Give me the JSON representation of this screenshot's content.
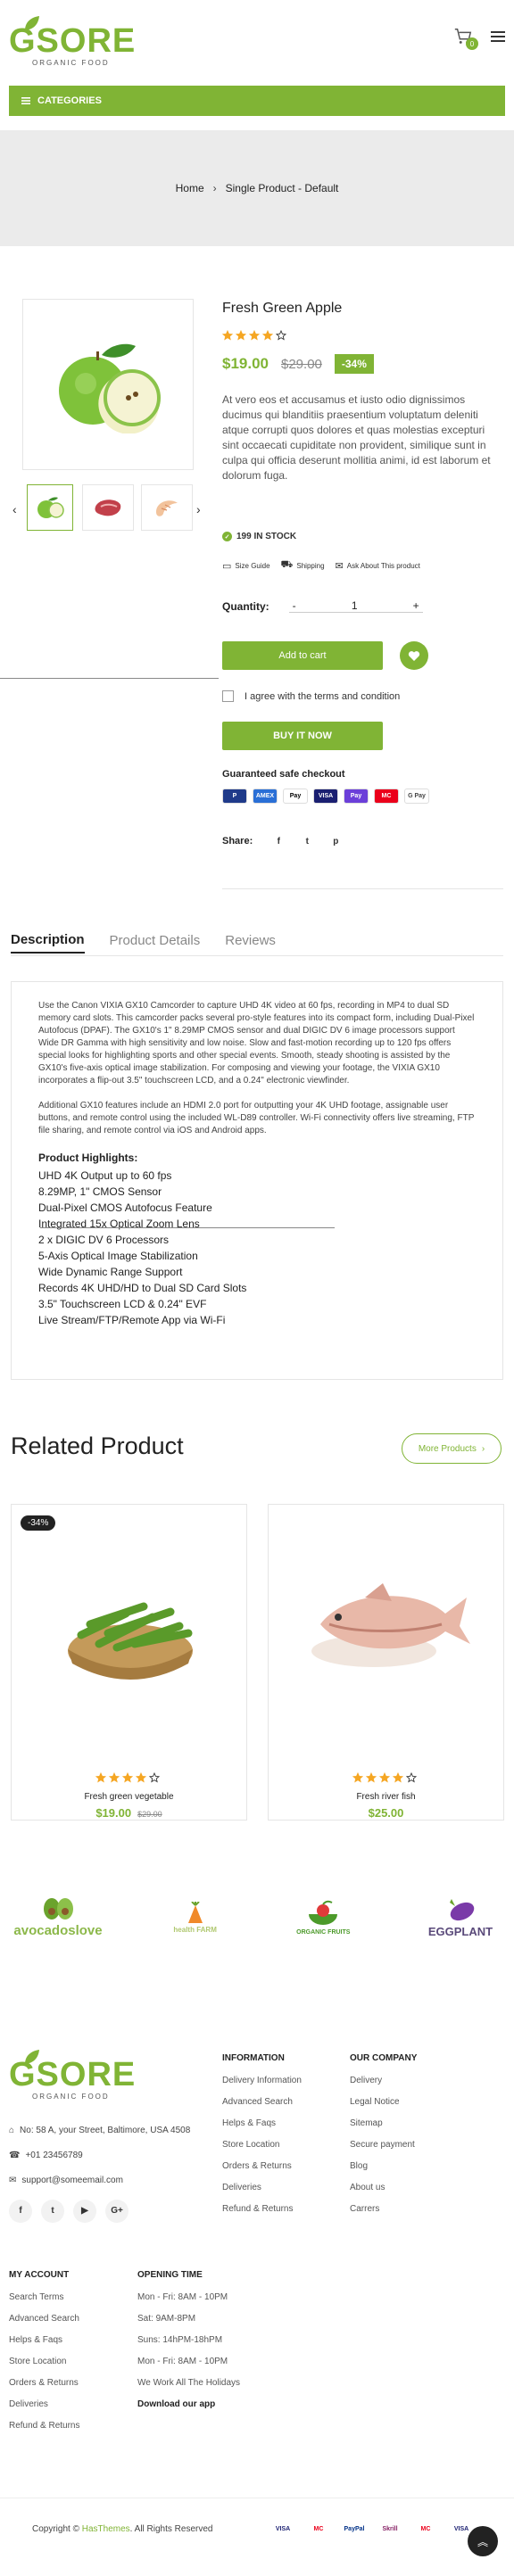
{
  "header": {
    "logo_main": "GSORE",
    "logo_sub": "ORGANIC FOOD",
    "cart_count": "0",
    "categories_label": "CATEGORIES"
  },
  "breadcrumb": {
    "home": "Home",
    "current": "Single Product - Default"
  },
  "product": {
    "title": "Fresh Green Apple",
    "price": "$19.00",
    "old_price": "$29.00",
    "discount": "-34%",
    "rating": 4,
    "description": "At vero eos et accusamus et iusto odio dignissimos ducimus qui blanditiis praesentium voluptatum deleniti atque corrupti quos dolores et quas molestias excepturi sint occaecati cupiditate non provident, similique sunt in culpa qui officia deserunt mollitia animi, id est laborum et dolorum fuga.",
    "stock": "199 IN STOCK",
    "size_guide": "Size Guide",
    "shipping": "Shipping",
    "ask": "Ask About This product",
    "quantity_label": "Quantity:",
    "quantity": "1",
    "minus": "-",
    "plus": "+",
    "add_to_cart": "Add to cart",
    "terms": "I agree with the terms and condition",
    "buy_now": "BUY IT NOW",
    "safe_checkout": "Guaranteed safe checkout",
    "share": "Share:",
    "payments": [
      "P",
      "AMEX",
      "Pay",
      "VISA",
      "Pay",
      "MC",
      "G Pay"
    ]
  },
  "tabs": [
    "Description",
    "Product Details",
    "Reviews"
  ],
  "description_tab": {
    "para1": "Use the Canon VIXIA GX10 Camcorder to capture UHD 4K video at 60 fps, recording in MP4 to dual SD memory card slots. This camcorder packs several pro-style features into its compact form, including Dual-Pixel Autofocus (DPAF). The GX10's 1\" 8.29MP CMOS sensor and dual DIGIC DV 6 image processors support Wide DR Gamma with high sensitivity and low noise. Slow and fast-motion recording up to 120 fps offers special looks for highlighting sports and other special events. Smooth, steady shooting is assisted by the GX10's five-axis optical image stabilization. For composing and viewing your footage, the VIXIA GX10 incorporates a flip-out 3.5\" touchscreen LCD, and a 0.24\" electronic viewfinder.",
    "para2": "Additional GX10 features include an HDMI 2.0 port for outputting your 4K UHD footage, assignable user buttons, and remote control using the included WL-D89 controller. Wi-Fi connectivity offers live streaming, FTP file sharing, and remote control via iOS and Android apps.",
    "highlights_title": "Product Highlights:",
    "highlights": [
      "UHD 4K Output up to 60 fps",
      "8.29MP, 1\" CMOS Sensor",
      "Dual-Pixel CMOS Autofocus Feature",
      "Integrated 15x Optical Zoom Lens",
      "2 x DIGIC DV 6 Processors",
      "5-Axis Optical Image Stabilization",
      "Wide Dynamic Range Support",
      "Records 4K UHD/HD to Dual SD Card Slots",
      "3.5\" Touchscreen LCD & 0.24\" EVF",
      "Live Stream/FTP/Remote App via Wi-Fi"
    ]
  },
  "related": {
    "title": "Related Product",
    "more": "More Products",
    "items": [
      {
        "badge": "-34%",
        "name": "Fresh green vegetable",
        "price": "$19.00",
        "old_price": "$29.00",
        "rating": 4
      },
      {
        "badge": "",
        "name": "Fresh river fish",
        "price": "$25.00",
        "old_price": "",
        "rating": 4
      }
    ]
  },
  "brands": [
    "avocadoslove",
    "health FARM",
    "ORGANIC FRUITS",
    "EGGPLANT"
  ],
  "footer": {
    "address": "No: 58 A, your Street, Baltimore, USA 4508",
    "phone": "+01 23456789",
    "email": "support@someemail.com",
    "information_title": "INFORMATION",
    "information": [
      "Delivery Information",
      "Advanced Search",
      "Helps & Faqs",
      "Store Location",
      "Orders & Returns",
      "Deliveries",
      "Refund & Returns"
    ],
    "company_title": "OUR COMPANY",
    "company": [
      "Delivery",
      "Legal Notice",
      "Sitemap",
      "Secure payment",
      "Blog",
      "About us",
      "Carrers"
    ],
    "account_title": "MY ACCOUNT",
    "account": [
      "Search Terms",
      "Advanced Search",
      "Helps & Faqs",
      "Store Location",
      "Orders & Returns",
      "Deliveries",
      "Refund & Returns"
    ],
    "hours_title": "OPENING TIME",
    "hours": [
      "Mon - Fri: 8AM - 10PM",
      "Sat: 9AM-8PM",
      "Suns: 14hPM-18hPM",
      "Mon - Fri: 8AM - 10PM",
      "We Work All The Holidays"
    ],
    "download": "Download our app",
    "copyright_prefix": "Copyright ©",
    "copyright_brand": "HasThemes",
    "copyright_suffix": ". All Rights Reserved",
    "pay_logos": [
      "VISA",
      "MC",
      "PayPal",
      "Skrill",
      "MC",
      "VISA"
    ]
  },
  "colors": {
    "accent": "#80b435",
    "star": "#f5a623",
    "dark": "#222222"
  }
}
